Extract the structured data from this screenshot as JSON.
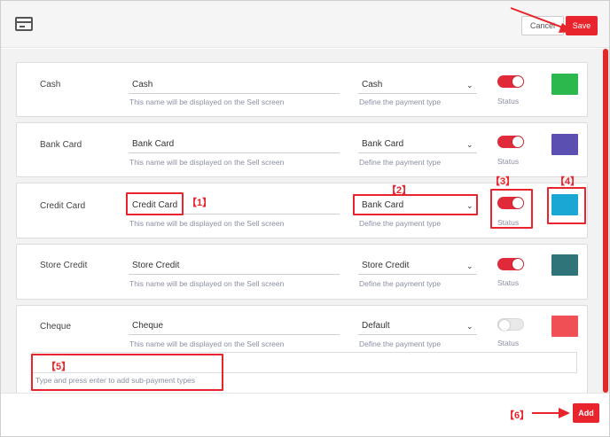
{
  "header": {
    "icon": "credit-card-icon",
    "cancel_label": "Cancel",
    "save_label": "Save"
  },
  "rows": [
    {
      "name": "Cash",
      "display_name": "Cash",
      "name_hint": "This name will be displayed on the Sell screen",
      "type": "Cash",
      "type_hint": "Define the payment type",
      "status_label": "Status",
      "status_on": true,
      "color": "#2db84d"
    },
    {
      "name": "Bank Card",
      "display_name": "Bank Card",
      "name_hint": "This name will be displayed on the Sell screen",
      "type": "Bank Card",
      "type_hint": "Define the payment type",
      "status_label": "Status",
      "status_on": true,
      "color": "#5b4fb1"
    },
    {
      "name": "Credit Card",
      "display_name": "Credit Card",
      "name_hint": "This name will be displayed on the Sell screen",
      "type": "Bank Card",
      "type_hint": "Define the payment type",
      "status_label": "Status",
      "status_on": true,
      "color": "#1aa7d4"
    },
    {
      "name": "Store Credit",
      "display_name": "Store Credit",
      "name_hint": "This name will be displayed on the Sell screen",
      "type": "Store Credit",
      "type_hint": "Define the payment type",
      "status_label": "Status",
      "status_on": true,
      "color": "#2e7478"
    },
    {
      "name": "Cheque",
      "display_name": "Cheque",
      "name_hint": "This name will be displayed on the Sell screen",
      "type": "Default",
      "type_hint": "Define the payment type",
      "status_label": "Status",
      "status_on": false,
      "color": "#ef4f55"
    }
  ],
  "sub_payment": {
    "hint": "Type and press enter to add sub-payment types"
  },
  "footer": {
    "add_label": "Add"
  },
  "annotations": {
    "m1": "【1】",
    "m2": "【2】",
    "m3": "【3】",
    "m4": "【4】",
    "m5": "【5】",
    "m6": "【6】",
    "color": "#e8242c"
  },
  "colors": {
    "accent": "#e8242c",
    "toggle_on": "#e02a3a"
  }
}
